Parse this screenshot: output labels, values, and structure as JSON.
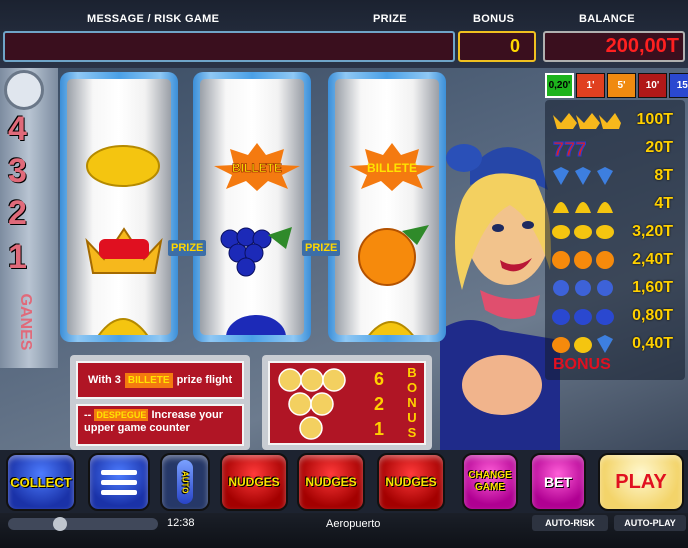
{
  "header": {
    "message_label": "MESSAGE / RISK GAME",
    "prize_label": "PRIZE",
    "bonus_label": "BONUS",
    "balance_label": "BALANCE",
    "bonus_value": "0",
    "balance_value": "200,00T"
  },
  "counter": {
    "digits": [
      "4",
      "3",
      "2",
      "1"
    ],
    "vertical_word": "GANES"
  },
  "reels": {
    "prize_left": "PRIZE",
    "prize_right": "PRIZE",
    "billete": "BILLETE",
    "symbols": [
      [
        "lemon",
        "crown",
        "bell"
      ],
      [
        "billete",
        "grapes",
        "plum"
      ],
      [
        "billete",
        "orange",
        "bell"
      ]
    ]
  },
  "denominations": [
    "0,20'",
    "1'",
    "5'",
    "10'",
    "15'"
  ],
  "paytable": {
    "rows": [
      {
        "symbol": "crown",
        "value": "100T"
      },
      {
        "symbol": "seven",
        "value": "20T"
      },
      {
        "symbol": "diamond",
        "value": "8T"
      },
      {
        "symbol": "bell",
        "value": "4T"
      },
      {
        "symbol": "lemon",
        "value": "3,20T"
      },
      {
        "symbol": "orange",
        "value": "2,40T"
      },
      {
        "symbol": "grapes",
        "value": "1,60T"
      },
      {
        "symbol": "plum",
        "value": "0,80T"
      },
      {
        "symbol": "mixed",
        "value": "0,40T"
      }
    ],
    "bonus_label": "BONUS"
  },
  "info": {
    "line1_prefix": "With 3",
    "line1_badge": "BILLETE",
    "line1_suffix": "prize flight",
    "line2_prefix": "--",
    "line2_badge": "DESPEGUE",
    "line2_text": "Increase your upper game counter"
  },
  "bonus_panel": {
    "counts": [
      "6",
      "2",
      "1"
    ],
    "word": "BONUS"
  },
  "buttons": {
    "collect": "COLLECT",
    "auto": "AUTO",
    "nudges": "NUDGES",
    "change_game": "CHANGE GAME",
    "bet": "BET",
    "play": "PLAY"
  },
  "status": {
    "time": "12:38",
    "location": "Aeropuerto",
    "auto_risk": "AUTO-RISK",
    "auto_play": "AUTO-PLAY"
  },
  "colors": {
    "accent_gold": "#ffd800",
    "field_bg": "#3a0f1e",
    "reel_frame": "#4aa0e6"
  }
}
